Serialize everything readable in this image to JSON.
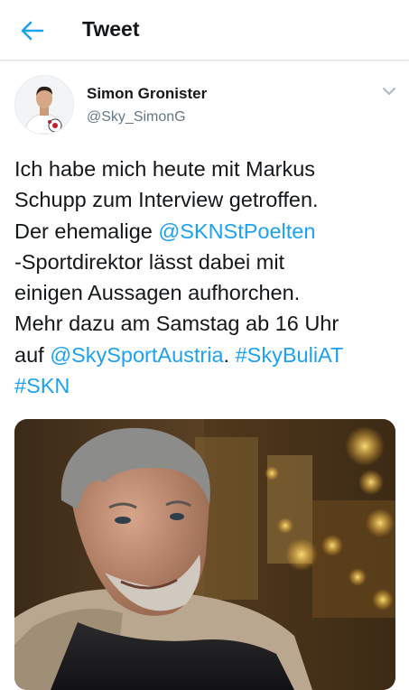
{
  "header": {
    "title": "Tweet",
    "back_icon": "arrow-left-icon",
    "accent_color": "#1da1f2"
  },
  "tweet": {
    "author": {
      "name": "Simon Gronister",
      "handle": "@Sky_SimonG",
      "avatar": "avatar-photo"
    },
    "menu_icon": "chevron-down-icon",
    "text": {
      "line1": "Ich habe mich heute mit Markus",
      "line2": "Schupp zum Interview getroffen.",
      "line3_prefix": "Der ehemalige ",
      "mention1": "@SKNStPoelten",
      "line4": "-Sportdirektor lässt dabei mit",
      "line5": "einigen Aussagen aufhorchen.",
      "line6": "Mehr dazu am Samstag ab 16 Uhr",
      "line7_prefix": "auf ",
      "mention2": "@SkySportAustria",
      "line7_sep": ". ",
      "hashtag1": "#SkyBuliAT",
      "hashtag2": "#SKN"
    },
    "media": {
      "type": "photo"
    }
  }
}
